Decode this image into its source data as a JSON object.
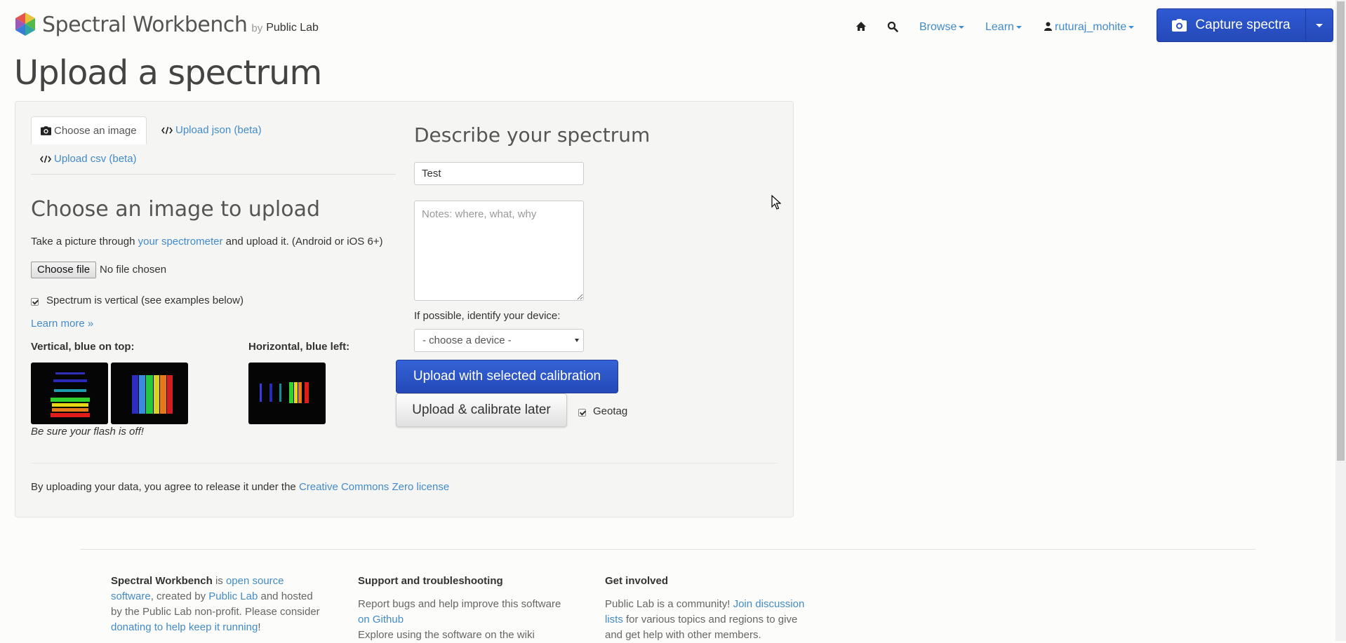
{
  "brand": {
    "name": "Spectral Workbench",
    "by": "by",
    "org": "Public Lab"
  },
  "nav": {
    "browse": "Browse",
    "learn": "Learn",
    "user": "ruturaj_mohite",
    "capture": "Capture spectra"
  },
  "page": {
    "title": "Upload a spectrum"
  },
  "tabs": {
    "choose_image": "Choose an image",
    "upload_json": "Upload json (beta)",
    "upload_csv": "Upload csv (beta)"
  },
  "upload": {
    "title": "Choose an image to upload",
    "instr_pre": "Take a picture through",
    "instr_link": "your spectrometer",
    "instr_post": "and upload it. (Android or iOS 6+)",
    "choose_file": "Choose file",
    "no_file": "No file chosen",
    "vertical_label": "Spectrum is vertical (see examples below)",
    "vertical_checked": true,
    "learn_more": "Learn more »",
    "ex_vertical": "Vertical, blue on top:",
    "ex_horizontal": "Horizontal, blue left:",
    "flash_note": "Be sure your flash is off!"
  },
  "describe": {
    "title": "Describe your spectrum",
    "title_value": "Test",
    "notes_placeholder": "Notes: where, what, why",
    "device_label": "If possible, identify your device:",
    "device_selected": "- choose a device -",
    "upload_calibrated": "Upload with selected calibration",
    "upload_later": "Upload & calibrate later",
    "geotag": "Geotag",
    "geotag_checked": true
  },
  "license": {
    "pre": "By uploading your data, you agree to release it under the",
    "link": "Creative Commons Zero license"
  },
  "footer": {
    "col1": {
      "name": "Spectral Workbench",
      "is": "is",
      "open_source": "open source software",
      "created_by": ", created by",
      "public_lab": "Public Lab",
      "hosted": "and hosted by the Public Lab non-profit. Please consider",
      "donate": "donating to help keep it running",
      "end": "!"
    },
    "col2": {
      "title": "Support and troubleshooting",
      "text": "Report bugs and help improve this software",
      "link": "on Github",
      "cut": "Explore using the software on the wiki"
    },
    "col3": {
      "title": "Get involved",
      "text": "Public Lab is a community!",
      "link": "Join discussion lists",
      "rest": "for various topics and regions to give and get help with other members."
    }
  },
  "colors": {
    "accent": "#428bca",
    "primary_button": "#2b50c4"
  },
  "icons": [
    "home-icon",
    "search-icon",
    "user-icon",
    "camera-icon",
    "code-icon"
  ]
}
